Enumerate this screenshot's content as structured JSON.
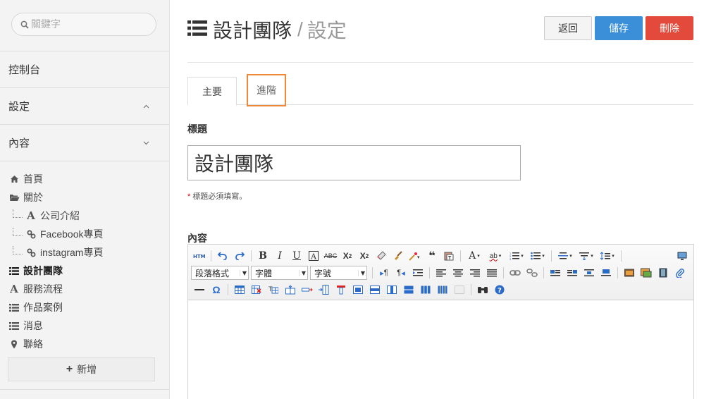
{
  "sidebar": {
    "search_placeholder": "關鍵字",
    "sections": [
      {
        "label": "控制台",
        "chevron": ""
      },
      {
        "label": "設定",
        "chevron": "⌃"
      },
      {
        "label": "內容",
        "chevron": "⌄"
      }
    ],
    "tree": [
      {
        "label": "首頁",
        "icon": "home-icon"
      },
      {
        "label": "關於",
        "icon": "folder-open-icon"
      },
      {
        "label": "公司介紹",
        "icon": "font-icon",
        "child": true
      },
      {
        "label": "Facebook專頁",
        "icon": "link-icon",
        "child": true
      },
      {
        "label": "instagram專頁",
        "icon": "link-icon",
        "child": true
      },
      {
        "label": "設計團隊",
        "icon": "list-icon",
        "active": true
      },
      {
        "label": "服務流程",
        "icon": "font-icon"
      },
      {
        "label": "作品案例",
        "icon": "list-icon"
      },
      {
        "label": "消息",
        "icon": "list-icon"
      },
      {
        "label": "聯絡",
        "icon": "map-marker-icon"
      }
    ],
    "add_label": "新增"
  },
  "header": {
    "title": "設計團隊",
    "separator": "/",
    "subtitle": "設定",
    "back_label": "返回",
    "save_label": "儲存",
    "delete_label": "刪除"
  },
  "tabs": [
    {
      "label": "主要",
      "active": true
    },
    {
      "label": "進階",
      "active": false
    }
  ],
  "form": {
    "title_label": "標題",
    "title_value": "設計團隊",
    "required_star": "*",
    "required_note": "標題必須填寫。",
    "content_label": "內容"
  },
  "editor": {
    "format_select": "段落格式",
    "font_select": "字體",
    "size_select": "字號"
  },
  "colors": {
    "save": "#3a8fd8",
    "delete": "#e34a3c",
    "highlight": "#f0883a"
  }
}
